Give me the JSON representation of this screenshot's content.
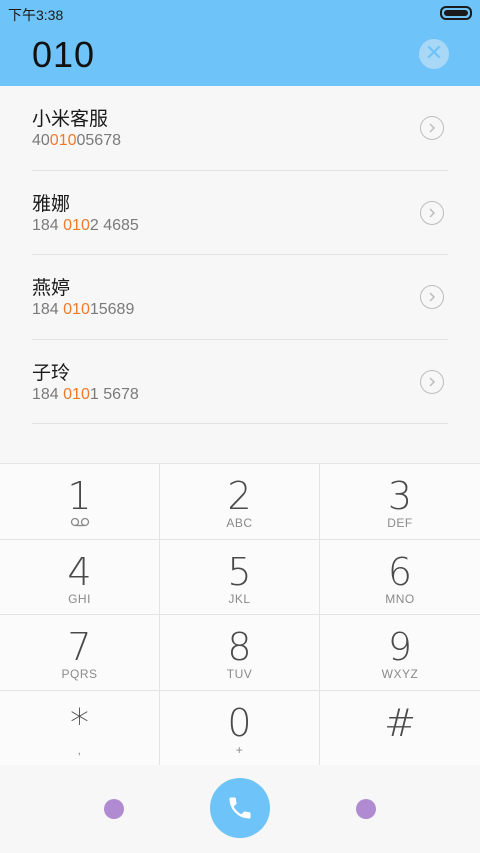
{
  "status_bar": {
    "time": "下午3:38"
  },
  "search": {
    "query": "010",
    "clear_icon": "close-icon"
  },
  "results": [
    {
      "name": "小米客服",
      "number_pre": "40",
      "number_match": "010",
      "number_post": "05678"
    },
    {
      "name": "雅娜",
      "number_pre": "184 ",
      "number_match": "010",
      "number_post": "2 4685"
    },
    {
      "name": "燕婷",
      "number_pre": "184 ",
      "number_match": "010",
      "number_post": "15689"
    },
    {
      "name": "子玲",
      "number_pre": "184 ",
      "number_match": "010",
      "number_post": "1 5678"
    }
  ],
  "keypad": [
    {
      "digit": "1",
      "sub": ""
    },
    {
      "digit": "2",
      "sub": "ABC"
    },
    {
      "digit": "3",
      "sub": "DEF"
    },
    {
      "digit": "4",
      "sub": "GHI"
    },
    {
      "digit": "5",
      "sub": "JKL"
    },
    {
      "digit": "6",
      "sub": "MNO"
    },
    {
      "digit": "7",
      "sub": "PQRS"
    },
    {
      "digit": "8",
      "sub": "TUV"
    },
    {
      "digit": "9",
      "sub": "WXYZ"
    },
    {
      "digit": "*",
      "sub": ","
    },
    {
      "digit": "0",
      "sub": "+"
    },
    {
      "digit": "#",
      "sub": ""
    }
  ],
  "colors": {
    "accent": "#6ec3f8",
    "match": "#f07a2a",
    "dot": "#b18bd1"
  }
}
